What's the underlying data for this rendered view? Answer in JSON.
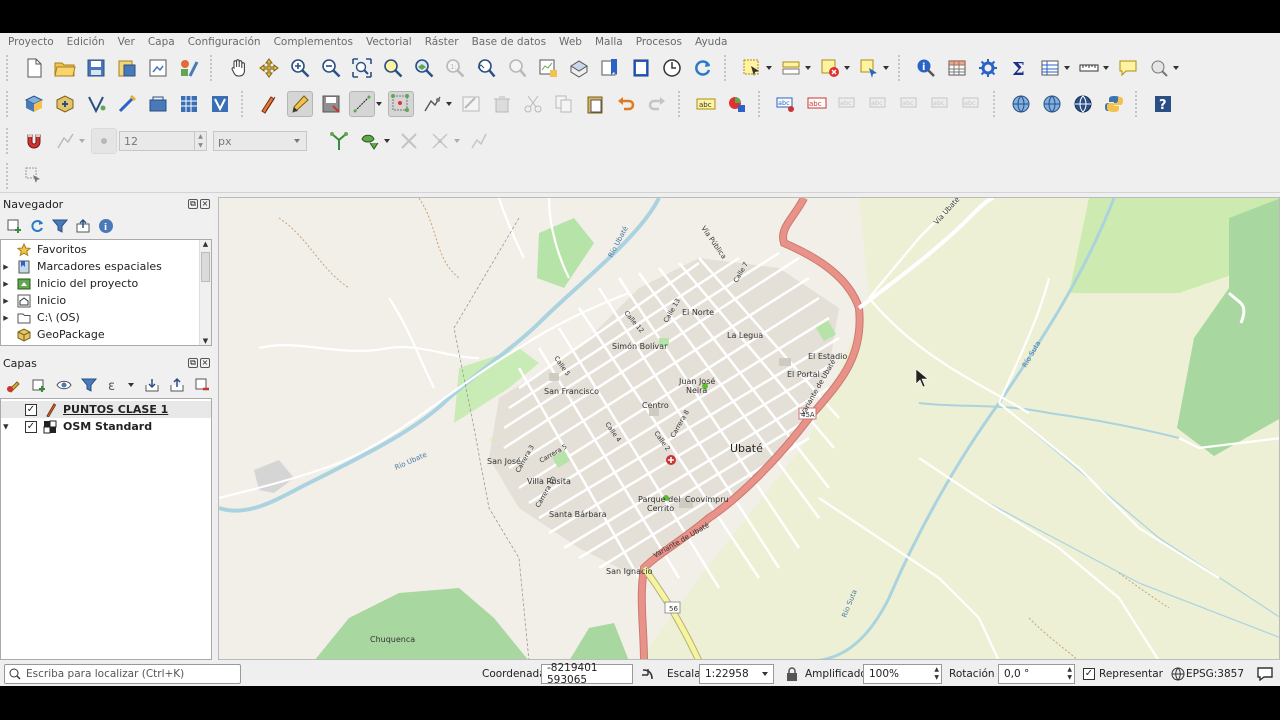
{
  "menu": [
    "Proyecto",
    "Edición",
    "Ver",
    "Capa",
    "Configuración",
    "Complementos",
    "Vectorial",
    "Ráster",
    "Base de datos",
    "Web",
    "Malla",
    "Procesos",
    "Ayuda"
  ],
  "digitizing": {
    "snap_tolerance": "12",
    "snap_units": "px"
  },
  "navigator": {
    "title": "Navegador",
    "items": [
      {
        "label": "Favoritos",
        "icon": "star-icon",
        "expandable": false
      },
      {
        "label": "Marcadores espaciales",
        "icon": "bookmark-icon",
        "expandable": true
      },
      {
        "label": "Inicio del proyecto",
        "icon": "project-home-icon",
        "expandable": true
      },
      {
        "label": "Inicio",
        "icon": "home-folder-icon",
        "expandable": true
      },
      {
        "label": "C:\\ (OS)",
        "icon": "folder-icon",
        "expandable": true
      },
      {
        "label": "GeoPackage",
        "icon": "geopackage-icon",
        "expandable": false
      }
    ]
  },
  "layers": {
    "title": "Capas",
    "items": [
      {
        "label": "PUNTOS CLASE 1",
        "checked": true,
        "icon": "point-layer-icon",
        "active": true
      },
      {
        "label": "OSM Standard",
        "checked": true,
        "icon": "xyz-tile-icon",
        "active": false
      }
    ]
  },
  "map": {
    "town": "Ubaté",
    "labels": {
      "rio_ubate_1": "Río Ubaté",
      "rio_ubate_2": "Río Ubate",
      "rio_suta_1": "Río Suta",
      "rio_suta_2": "Río Suta",
      "via_publica": "Vía Pública",
      "via_ubate": "Vía Ubaté-Ca",
      "variante_1": "Variante de Ubaté",
      "variante_2": "Variante de Ubaté",
      "el_norte": "El Norte",
      "simon_bolivar": "Simón Bolívar",
      "la_legua": "La Legua",
      "el_estadio": "El Estadio",
      "el_portal": "El Portal",
      "juan_jose_neira_1": "Juan José",
      "juan_jose_neira_2": "Neira",
      "san_francisco": "San Francisco",
      "centro": "Centro",
      "san_jose": "San José",
      "villa_rosita": "Villa Rosita",
      "santa_barbara": "Santa Bárbara",
      "parque_del_cerrito_1": "Parque del",
      "parque_del_cerrito_2": "Cerrito",
      "coovimpru": "Coovimpru",
      "san_ignacio": "San Ignacio",
      "chuquenca": "Chuquenca",
      "route_45a": "45A",
      "route_56": "56",
      "calle_5": "Calle 5",
      "calle_12": "Calle 12",
      "calle_13": "Calle 13",
      "calle_7": "Calle 7",
      "calle_4": "Calle 4",
      "calle_2": "Calle 2",
      "carrera_3": "Carrera 3",
      "carrera_5": "Carrera 5",
      "carrera_8": "Carrera 8",
      "carrera_10": "Carrera 10"
    }
  },
  "status": {
    "locator_placeholder": "Escriba para localizar (Ctrl+K)",
    "coordinate_label": "Coordenada",
    "coordinate_value": "-8219401  593065",
    "scale_label": "Escala",
    "scale_value": "1:22958",
    "magnifier_label": "Amplificador",
    "magnifier_value": "100%",
    "rotation_label": "Rotación",
    "rotation_value": "0,0 °",
    "render_label": "Representar",
    "render_checked": true,
    "crs": "EPSG:3857"
  },
  "colors": {
    "map_bg": "#f2efe9",
    "farmland": "#eef0d5",
    "road_primary": "#e8928a",
    "road_secondary": "#f7f4a0",
    "water": "#aad3df",
    "green": "#b5e3a8",
    "forest": "#a8d8a0"
  }
}
